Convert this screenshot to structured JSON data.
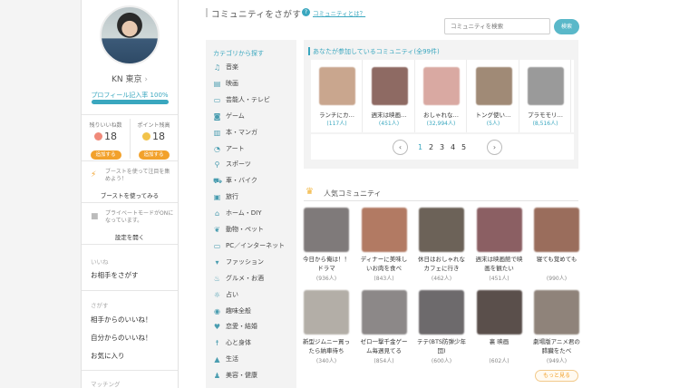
{
  "profile": {
    "name": "KN 東京",
    "progress_label": "プロフィール記入率",
    "progress_value": "100%",
    "progress": 1.0
  },
  "stats": {
    "likes_label": "残りいいね数",
    "likes_value": "18",
    "points_label": "ポイント残高",
    "points_value": "18",
    "add_label": "追加する"
  },
  "boost": {
    "text": "ブーストを使って注目を集めよう！",
    "link": "ブーストを使ってみる"
  },
  "private_mode": {
    "text": "プライベートモードがONになっています。",
    "link": "設定を開く"
  },
  "menu": {
    "likes_section": "いいね",
    "find_partner": "お相手をさがす",
    "search_section": "さがす",
    "likes_from": "相手からのいいね！",
    "likes_to": "自分からのいいね！",
    "favorites": "お気に入り",
    "matching_section": "マッチング"
  },
  "header": {
    "title": "コミュニティをさがす",
    "help_link": "コミュニティとは？",
    "search_placeholder": "コミュニティを検索",
    "search_button": "検索"
  },
  "categories": {
    "title": "カテゴリから探す",
    "items": [
      {
        "label": "音楽",
        "icon": "♫"
      },
      {
        "label": "映画",
        "icon": "▤"
      },
      {
        "label": "芸能人・テレビ",
        "icon": "▭"
      },
      {
        "label": "ゲーム",
        "icon": "◙"
      },
      {
        "label": "本・マンガ",
        "icon": "▥"
      },
      {
        "label": "アート",
        "icon": "◔"
      },
      {
        "label": "スポーツ",
        "icon": "⚲"
      },
      {
        "label": "車・バイク",
        "icon": "⛟"
      },
      {
        "label": "旅行",
        "icon": "▣"
      },
      {
        "label": "ホーム・DIY",
        "icon": "⌂"
      },
      {
        "label": "動物・ペット",
        "icon": "❦"
      },
      {
        "label": "PC／インターネット",
        "icon": "▭"
      },
      {
        "label": "ファッション",
        "icon": "▾"
      },
      {
        "label": "グルメ・お酒",
        "icon": "♨"
      },
      {
        "label": "占い",
        "icon": "☼"
      },
      {
        "label": "趣味全般",
        "icon": "◉"
      },
      {
        "label": "恋愛・結婚",
        "icon": "♥"
      },
      {
        "label": "心と身体",
        "icon": "☨"
      },
      {
        "label": "生活",
        "icon": "▲"
      },
      {
        "label": "美容・健康",
        "icon": "♟"
      }
    ]
  },
  "joined": {
    "title": "あなたが参加しているコミュニティ(全99件)",
    "cards": [
      {
        "name": "ランチにカ…",
        "count": "(117人)",
        "color": "#c9a68e"
      },
      {
        "name": "週末は映画…",
        "count": "(451人)",
        "color": "#8e6a63"
      },
      {
        "name": "おしゃれな…",
        "count": "(32,994人)",
        "color": "#d9a9a2"
      },
      {
        "name": "トング使い…",
        "count": "(5人)",
        "color": "#a08a76"
      },
      {
        "name": "プラモモリ…",
        "count": "(8,516人)",
        "color": "#9a9a9a"
      }
    ],
    "pages": [
      "1",
      "2",
      "3",
      "4",
      "5"
    ],
    "prev": "‹",
    "next": "›"
  },
  "popular": {
    "title": "人気コミュニティ",
    "more": "もっと見る",
    "cards": [
      {
        "name": "今日から俺は！！ドラマ",
        "count": "(936人)",
        "color": "#7f7a7a"
      },
      {
        "name": "ディナーに美味しいお肉を食べ",
        "count": "(843人)",
        "color": "#b27a63"
      },
      {
        "name": "休日はおしゃれなカフェに行き",
        "count": "(462人)",
        "color": "#6c6258"
      },
      {
        "name": "週末は映画館で映画を観たい",
        "count": "(451人)",
        "color": "#8b5f63"
      },
      {
        "name": "寝ても覚めても",
        "count": "(990人)",
        "color": "#9a6d5c"
      },
      {
        "name": "新型ジムニー買ったら納車待ち",
        "count": "(340人)",
        "color": "#b3aea7"
      },
      {
        "name": "ゼロ一撃千金ゲーム毎週見てる",
        "count": "(854人)",
        "color": "#8c8888"
      },
      {
        "name": "テテ(BTS防弾少年団)",
        "count": "(600人)",
        "color": "#6d6a6c"
      },
      {
        "name": "裏 映画",
        "count": "(602人)",
        "color": "#5a4f4b"
      },
      {
        "name": "劇場版アニメ君の膵臓をたべ",
        "count": "(949人)",
        "color": "#8f837a"
      }
    ]
  }
}
